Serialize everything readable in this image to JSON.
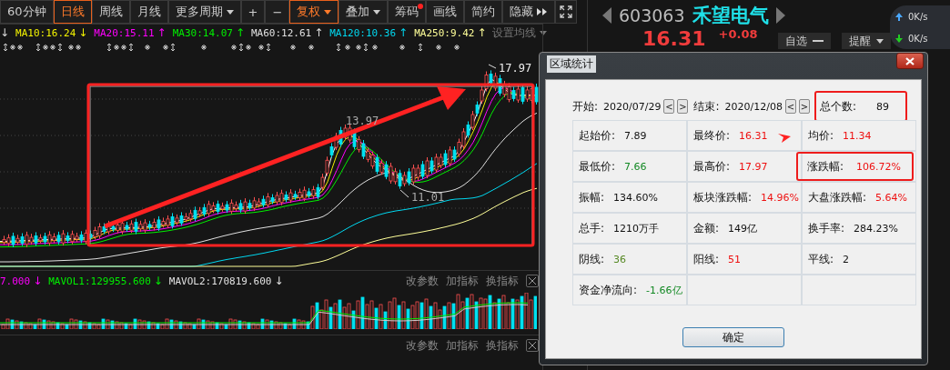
{
  "toolbar": {
    "periods": [
      {
        "label": "60分钟",
        "selected": false,
        "kind": "plain"
      },
      {
        "label": "日线",
        "selected": true,
        "kind": "plain"
      },
      {
        "label": "周线",
        "selected": false,
        "kind": "plain"
      },
      {
        "label": "月线",
        "selected": false,
        "kind": "plain"
      },
      {
        "label": "更多周期",
        "selected": false,
        "kind": "dropdown"
      }
    ],
    "tools": [
      {
        "label": "+",
        "selected": false,
        "kind": "plain"
      },
      {
        "label": "−",
        "selected": false,
        "kind": "plain"
      },
      {
        "label": "复权",
        "selected": true,
        "kind": "dropdown"
      },
      {
        "label": "叠加",
        "selected": false,
        "kind": "dropdown"
      },
      {
        "label": "筹码",
        "selected": false,
        "kind": "badge"
      },
      {
        "label": "画线",
        "selected": false,
        "kind": "plain"
      },
      {
        "label": "简约",
        "selected": false,
        "kind": "plain"
      },
      {
        "label": "隐藏",
        "selected": false,
        "kind": "expand"
      }
    ]
  },
  "ma_legend": {
    "lead_arrow": "↓",
    "items": [
      {
        "label": "MA10:16.24",
        "arrow": "↓",
        "color": "#f2f200"
      },
      {
        "label": "MA20:15.11",
        "arrow": "↑",
        "color": "#ff00ff"
      },
      {
        "label": "MA30:14.07",
        "arrow": "↑",
        "color": "#00ee00"
      },
      {
        "label": "MA60:12.61",
        "arrow": "↑",
        "color": "#e0e0e0"
      },
      {
        "label": "MA120:10.36",
        "arrow": "↑",
        "color": "#00d8f0"
      },
      {
        "label": "MA250:9.42",
        "arrow": "↑",
        "color": "#ffff99"
      }
    ],
    "settings": "设置均线"
  },
  "chart": {
    "labels": [
      "17.97",
      "13.97",
      "11.01"
    ]
  },
  "volume": {
    "legend": [
      {
        "label": "7.000",
        "arrow": "↓",
        "color": "#ff00ff"
      },
      {
        "label": "MAVOL1:129955.600",
        "arrow": "↓",
        "color": "#00ee00"
      },
      {
        "label": "MAVOL2:170819.600",
        "arrow": "↓",
        "color": "#e0e0e0"
      }
    ],
    "actions": [
      "改参数",
      "加指标",
      "换指标"
    ]
  },
  "indicator2": {
    "actions": [
      "改参数",
      "加指标",
      "换指标"
    ]
  },
  "quote": {
    "code": "603063",
    "name": "禾望电气",
    "price": "16.31",
    "change": "+0.08",
    "buttons": [
      {
        "label": "自选",
        "kind": "minus"
      },
      {
        "label": "提醒",
        "kind": "dropdown"
      }
    ]
  },
  "network": {
    "upload": "0K/s",
    "download": "0K/s"
  },
  "dialog": {
    "title": "区域统计",
    "start_label": "开始:",
    "start": "2020/07/29",
    "end_label": "结束:",
    "end": "2020/12/08",
    "prev": "<",
    "next": ">",
    "count": {
      "label": "总个数:",
      "value": "89",
      "highlighted": true
    },
    "cells": [
      {
        "label": "起始价:",
        "value": "7.89",
        "color": "#111111",
        "highlighted": false
      },
      {
        "label": "最终价:",
        "value": "16.31",
        "color": "#ee1111",
        "highlighted": false
      },
      {
        "label": "均价:",
        "value": "11.34",
        "color": "#ee1111",
        "highlighted": false
      },
      {
        "label": "最低价:",
        "value": "7.66",
        "color": "#118822",
        "highlighted": false
      },
      {
        "label": "最高价:",
        "value": "17.97",
        "color": "#ee1111",
        "highlighted": false
      },
      {
        "label": "涨跌幅:",
        "value": "106.72%",
        "color": "#ee1111",
        "highlighted": true
      },
      {
        "label": "振幅:",
        "value": "134.60%",
        "color": "#111111",
        "highlighted": false
      },
      {
        "label": "板块涨跌幅:",
        "value": "14.96%",
        "color": "#ee1111",
        "highlighted": false
      },
      {
        "label": "大盘涨跌幅:",
        "value": "5.64%",
        "color": "#ee1111",
        "highlighted": false
      },
      {
        "label": "总手:",
        "value": "1210万手",
        "color": "#111111",
        "highlighted": false
      },
      {
        "label": "金额:",
        "value": "149亿",
        "color": "#111111",
        "highlighted": false
      },
      {
        "label": "换手率:",
        "value": "284.23%",
        "color": "#111111",
        "highlighted": false
      },
      {
        "label": "阴线:",
        "value": "36",
        "color": "#558822",
        "highlighted": false
      },
      {
        "label": "阳线:",
        "value": "51",
        "color": "#ee1111",
        "highlighted": false
      },
      {
        "label": "平线:",
        "value": "2",
        "color": "#111111",
        "highlighted": false
      },
      {
        "label": "资金净流向:",
        "value": "-1.66亿",
        "color": "#118822",
        "highlighted": false
      }
    ],
    "ok": "确定"
  }
}
